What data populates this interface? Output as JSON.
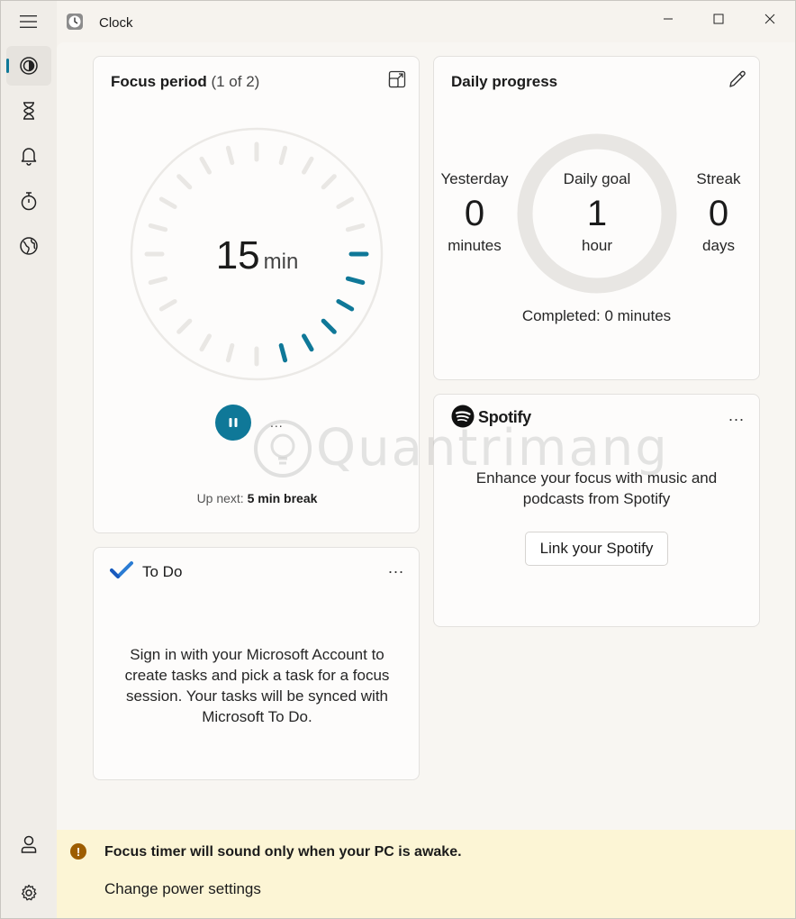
{
  "window": {
    "title": "Clock",
    "accent": "#0f7898"
  },
  "sidebar": {
    "items": [
      {
        "name": "focus-sessions",
        "icon": "focus-icon",
        "active": true
      },
      {
        "name": "timer",
        "icon": "hourglass-icon"
      },
      {
        "name": "alarm",
        "icon": "bell-icon"
      },
      {
        "name": "stopwatch",
        "icon": "stopwatch-icon"
      },
      {
        "name": "world-clock",
        "icon": "globe-icon"
      }
    ],
    "bottom": [
      {
        "name": "account",
        "icon": "person-icon"
      },
      {
        "name": "settings",
        "icon": "gear-icon"
      }
    ]
  },
  "focus": {
    "title": "Focus period",
    "count": "(1 of 2)",
    "time_value": "15",
    "time_unit": "min",
    "more": "...",
    "up_next_label": "Up next:",
    "up_next_value": "5 min break"
  },
  "todo": {
    "title": "To Do",
    "more": "...",
    "message_lines": [
      "Sign in with your Microsoft Account to",
      "create tasks and pick a task for a focus",
      "session. Your tasks will be synced with",
      "Microsoft To Do."
    ]
  },
  "daily": {
    "title": "Daily progress",
    "yesterday_label": "Yesterday",
    "yesterday_value": "0",
    "yesterday_unit": "minutes",
    "goal_label": "Daily goal",
    "goal_value": "1",
    "goal_unit": "hour",
    "streak_label": "Streak",
    "streak_value": "0",
    "streak_unit": "days",
    "completed": "Completed: 0 minutes"
  },
  "spotify": {
    "brand": "Spotify",
    "more": "...",
    "message_lines": [
      "Enhance your focus with music and",
      "podcasts from Spotify"
    ],
    "link_button": "Link your Spotify"
  },
  "notice": {
    "title": "Focus timer will sound only when your PC is awake.",
    "link": "Change power settings",
    "icon": "!"
  },
  "watermark": {
    "text": "Quantrimang"
  }
}
